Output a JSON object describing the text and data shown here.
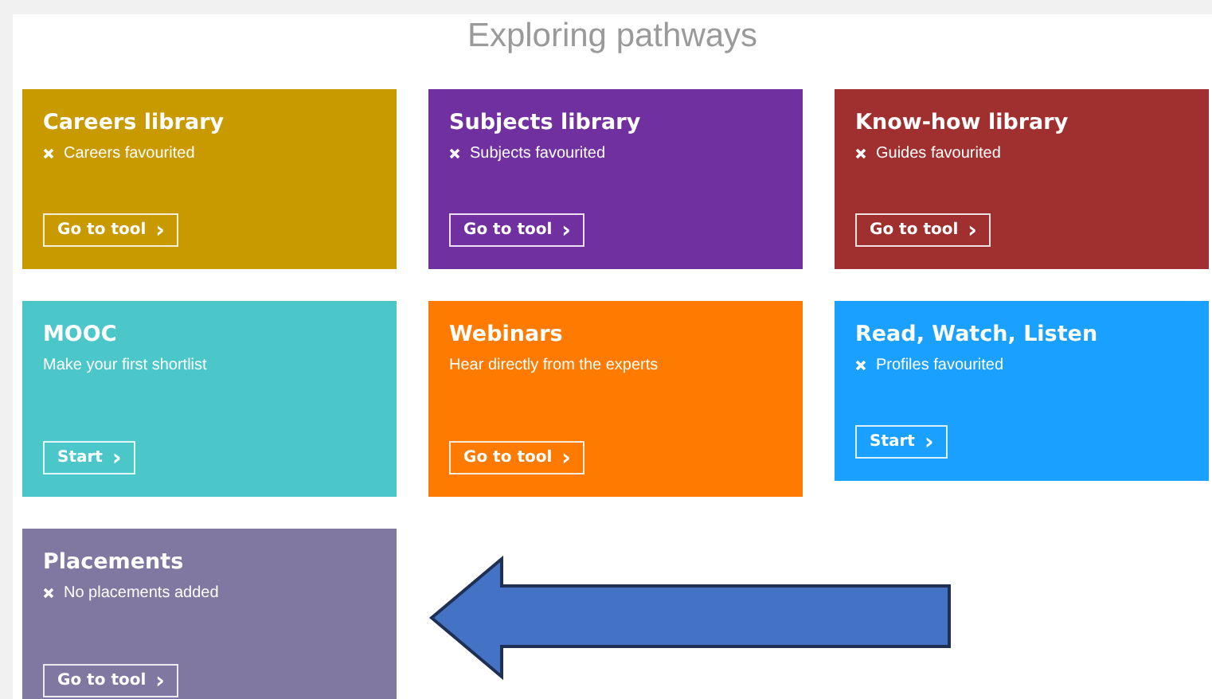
{
  "title": "Exploring pathways",
  "cards": [
    {
      "title": "Careers library",
      "color": "#c89a00",
      "line": {
        "kind": "status",
        "text": "Careers favourited"
      },
      "button": "Go to tool",
      "chevron": "›"
    },
    {
      "title": "Subjects library",
      "color": "#7030a0",
      "line": {
        "kind": "status",
        "text": "Subjects favourited"
      },
      "button": "Go to tool",
      "chevron": "›"
    },
    {
      "title": "Know-how library",
      "color": "#a03030",
      "line": {
        "kind": "status",
        "text": "Guides favourited"
      },
      "button": "Go to tool",
      "chevron": "›"
    },
    {
      "title": "MOOC",
      "color": "#4cc7c9",
      "line": {
        "kind": "description",
        "text": "Make your first shortlist"
      },
      "button": "Start",
      "chevron": "›"
    },
    {
      "title": "Webinars",
      "color": "#ff7a00",
      "line": {
        "kind": "description",
        "text": "Hear directly from the experts"
      },
      "button": "Go to tool",
      "chevron": "›"
    },
    {
      "title": "Read, Watch, Listen",
      "color": "#1aa0ff",
      "line": {
        "kind": "status",
        "text": "Profiles favourited"
      },
      "button": "Start",
      "chevron": "›"
    },
    {
      "title": "Placements",
      "color": "#8078a0",
      "line": {
        "kind": "status",
        "text": "No placements added"
      },
      "button": "Go to tool",
      "chevron": "›"
    }
  ]
}
